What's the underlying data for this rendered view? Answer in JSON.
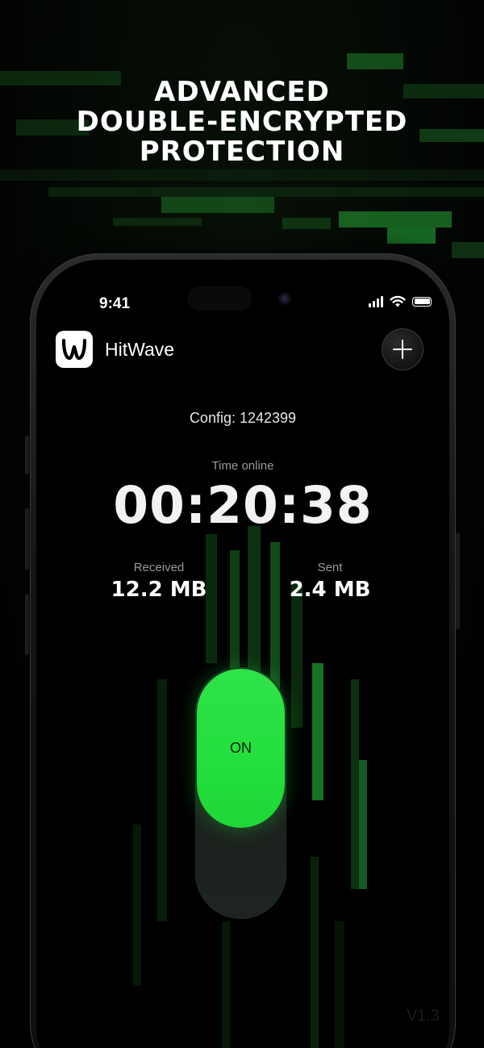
{
  "headline": {
    "line1": "ADVANCED",
    "line2": "DOUBLE-ENCRYPTED",
    "line3": "PROTECTION"
  },
  "status_bar": {
    "time": "9:41",
    "icons": [
      "cellular-signal-icon",
      "wifi-icon",
      "battery-icon"
    ]
  },
  "app": {
    "name": "HitWave",
    "logo_icon": "wave-logo-icon",
    "add_icon": "plus-icon"
  },
  "connection": {
    "config": "Config: 1242399",
    "time_label": "Time online",
    "time_value": "00:20:38",
    "received_label": "Received",
    "received_value": "12.2 MB",
    "sent_label": "Sent",
    "sent_value": "2.4 MB"
  },
  "toggle": {
    "label": "ON",
    "state": "on"
  },
  "footer": {
    "version": "V1.3"
  },
  "colors": {
    "accent_green": "#24df3d",
    "background": "#000000",
    "text_primary": "#ffffff",
    "text_secondary": "#9a9a9a"
  }
}
